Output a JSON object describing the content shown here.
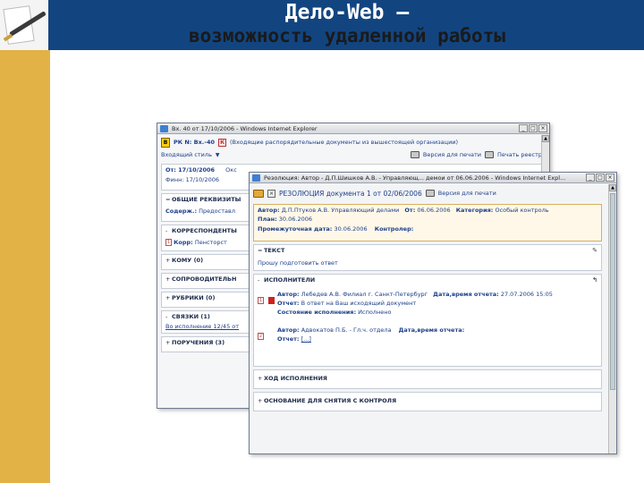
{
  "slide": {
    "title_line1": "Дело-Web –",
    "title_line2": "возможность удаленной работы",
    "colors": {
      "band": "#124580",
      "strip": "#e2b246"
    }
  },
  "window1": {
    "title": "Вх. 40 от 17/10/2006 - Windows Internet Explorer",
    "header_badge": "В",
    "reg_number": "РК N: Вх.-40",
    "doc_group": "(Входящие распорядительные документы из вышестоящей организации)",
    "print_button": "Версия для печати",
    "reestr_button": "Печать реестра",
    "doc_kind_label": "Входящий стиль",
    "from_line": "От: 17/10/2006",
    "from_suffix": "Окс",
    "recipient_line": "Финн: 17/10/2006",
    "sections": [
      {
        "toggle": "=",
        "title": "ОБЩИЕ РЕКВИЗИТЫ"
      },
      {
        "toggle": "-",
        "title": "КОРРЕСПОНДЕНТЫ"
      },
      {
        "toggle": "+",
        "title": "КОМУ (0)"
      },
      {
        "toggle": "+",
        "title": "СОПРОВОДИТЕЛЬН"
      },
      {
        "toggle": "+",
        "title": "РУБРИКИ (0)"
      },
      {
        "toggle": "-",
        "title": "СВЯЗКИ (1)"
      },
      {
        "toggle": "+",
        "title": "ПОРУЧЕНИЯ (3)"
      }
    ],
    "content_label": "Содерж.:",
    "content_value": "Предоставл",
    "corr_label": "Корр:",
    "corr_value": "Пенсторст",
    "link_text": "Во исполнение  12/45 от"
  },
  "window2": {
    "title": "Резолюция: Автор - Д.П.Шишков А.В. - Управляющ... демои от 06.06.2006 - Windows Internet Expl...",
    "resolution_heading": "РЕЗОЛЮЦИЯ документа  1 от 02/06/2006",
    "print_button": "Версия для печати",
    "author_label": "Автор:",
    "author_value": "Д.П.Птуков А.В.  Управляющий делами",
    "from_label": "От:",
    "from_value": "06.06.2006",
    "category_label": "Категория:",
    "category_value": "Особый контроль",
    "plan_label": "План:",
    "plan_value": "30.06.2006",
    "interim_label": "Промежуточная дата:",
    "interim_value": "30.06.2006",
    "controller_label": "Контролер:",
    "text_section": "ТЕКСТ",
    "text_body": "Прошу подготовить ответ",
    "executors_section": "ИСПОЛНИТЕЛИ",
    "executors": [
      {
        "num": "1",
        "author_label": "Автор:",
        "author_value": "Лебедев А.В.  Филиал г. Санкт-Петербург",
        "datetime_label": "Дата,время отчета:",
        "datetime_value": "27.07.2006 15:05",
        "report_label": "Отчет:",
        "report_value": "В ответ на Ваш исходящий документ",
        "status_label": "Состояние исполнения:",
        "status_value": "Исполнено"
      },
      {
        "num": "2",
        "author_label": "Автор:",
        "author_value": "Адвокатов П.Б. - Гл.ч. отдела",
        "datetime_label": "Дата,время отчета:",
        "datetime_value": "",
        "report_label": "Отчет:",
        "report_value": "[...]"
      }
    ],
    "bottom_sections": [
      {
        "toggle": "+",
        "title": "ХОД ИСПОЛНЕНИЯ"
      },
      {
        "toggle": "+",
        "title": "ОСНОВАНИЕ ДЛЯ СНЯТИЯ С КОНТРОЛЯ"
      }
    ]
  }
}
